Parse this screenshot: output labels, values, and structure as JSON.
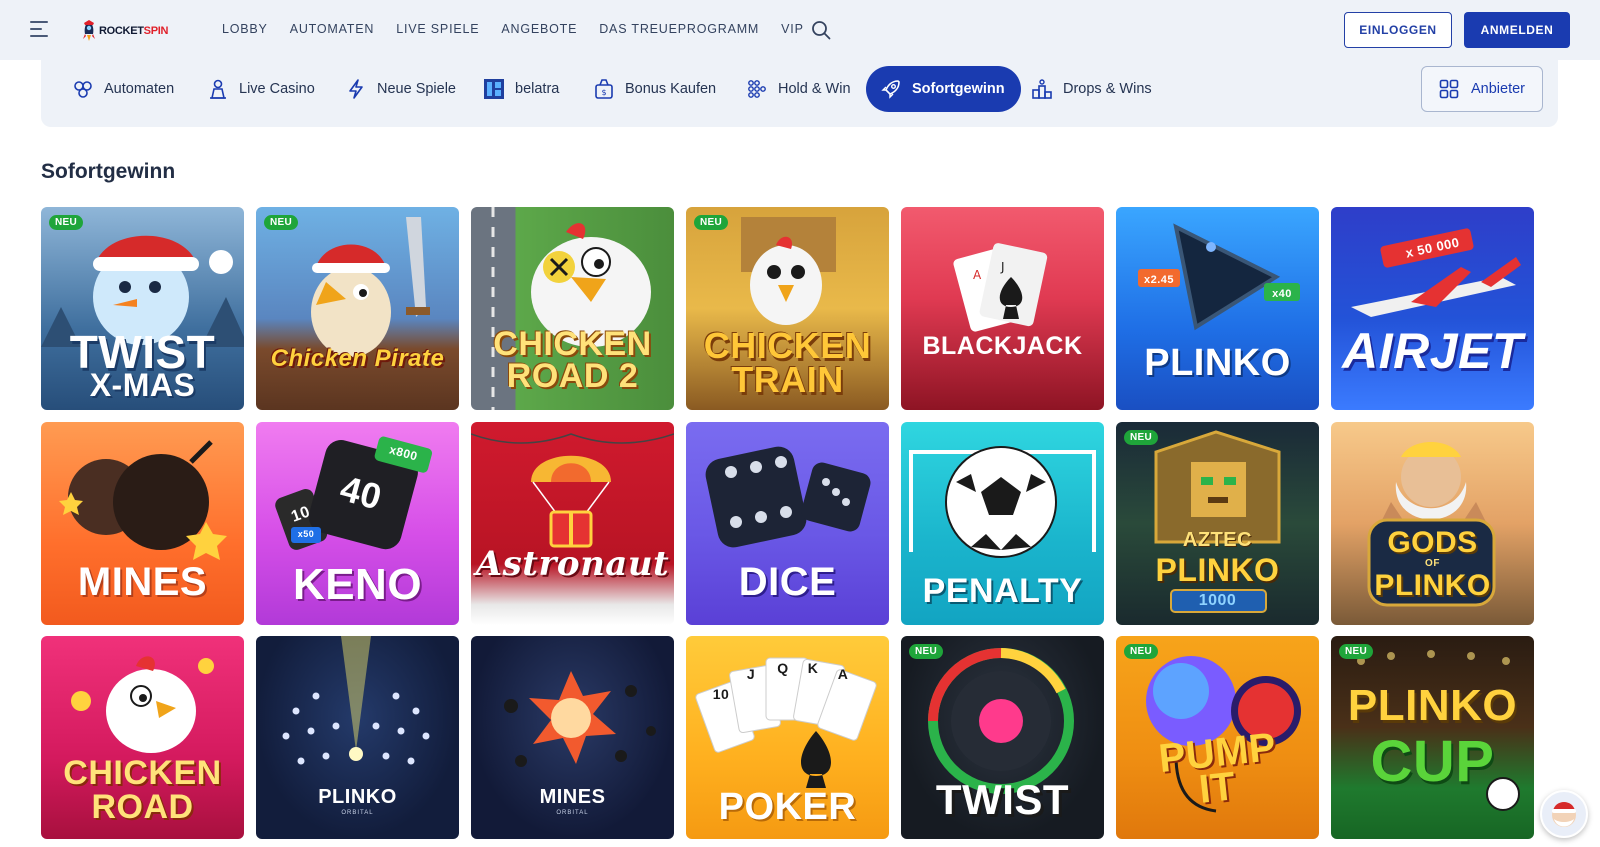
{
  "header": {
    "logo_text_a": "ROCKET",
    "logo_text_b": "SPIN",
    "nav": [
      "LOBBY",
      "AUTOMATEN",
      "LIVE SPIELE",
      "ANGEBOTE",
      "DAS TREUEPROGRAMM",
      "VIP"
    ],
    "login_label": "EINLOGGEN",
    "register_label": "ANMELDEN"
  },
  "categories": [
    {
      "label": "Automaten",
      "icon": "slot-icon"
    },
    {
      "label": "Live Casino",
      "icon": "dealer-icon"
    },
    {
      "label": "Neue Spiele",
      "icon": "lightning-icon"
    },
    {
      "label": "belatra",
      "icon": "belatra-logo-icon"
    },
    {
      "label": "Bonus Kaufen",
      "icon": "bag-icon"
    },
    {
      "label": "Hold & Win",
      "icon": "dots-grid-icon"
    },
    {
      "label": "Sofortgewinn",
      "icon": "rocket-icon",
      "active": true
    },
    {
      "label": "Drops & Wins",
      "icon": "podium-icon"
    }
  ],
  "providers_label": "Anbieter",
  "section_title": "Sofortgewinn",
  "new_badge": "NEU",
  "games": [
    {
      "title": "TWIST",
      "title2": "X-MAS",
      "new": true
    },
    {
      "title": "Chicken Pirate",
      "new": true
    },
    {
      "title": "CHICKEN",
      "title2": "ROAD 2",
      "new": false
    },
    {
      "title": "CHICKEN",
      "title2": "TRAIN",
      "new": true
    },
    {
      "title": "BLACKJACK",
      "new": false
    },
    {
      "title": "PLINKO",
      "new": false,
      "mult_left": "x2.45",
      "mult_right": "x40"
    },
    {
      "title": "AIRJET",
      "new": false,
      "mult": "x 50 000"
    },
    {
      "title": "MINES",
      "new": false
    },
    {
      "title": "KENO",
      "new": false,
      "mult": "x800",
      "num": "40",
      "num2": "10",
      "mult2": "x50"
    },
    {
      "title": "Astronaut",
      "new": false
    },
    {
      "title": "DICE",
      "new": false
    },
    {
      "title": "PENALTY",
      "new": false
    },
    {
      "title": "AZTEC",
      "title2": "PLINKO",
      "title3": "1000",
      "new": true
    },
    {
      "title": "GODS",
      "title2": "OF",
      "title3": "PLINKO",
      "new": false
    },
    {
      "title": "CHICKEN",
      "title2": "ROAD",
      "new": false
    },
    {
      "title": "PLINKO",
      "sub": "ORBITAL",
      "new": false
    },
    {
      "title": "MINES",
      "sub": "ORBITAL",
      "new": false
    },
    {
      "title": "POKER",
      "new": false,
      "cards": [
        "10",
        "J",
        "Q",
        "K",
        "A"
      ]
    },
    {
      "title": "TWIST",
      "new": true
    },
    {
      "title": "PUMP",
      "title2": "IT",
      "new": true
    },
    {
      "title": "PLINKO",
      "title2": "CUP",
      "new": true
    }
  ]
}
